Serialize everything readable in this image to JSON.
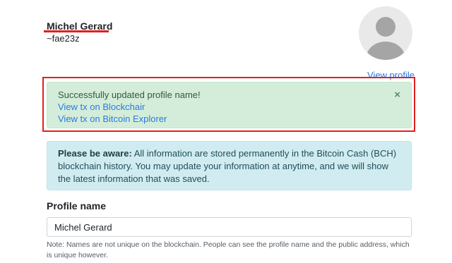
{
  "profile": {
    "name": "Michel Gerard",
    "handle": "~fae23z",
    "view_profile_label": "View profile"
  },
  "success_alert": {
    "message": "Successfully updated profile name!",
    "link_blockchair": "View tx on Blockchair",
    "link_explorer": "View tx on Bitcoin Explorer",
    "close_symbol": "×"
  },
  "info_alert": {
    "bold_label": "Please be aware:",
    "text": " All information are stored permanently in the Bitcoin Cash (BCH) blockchain history. You may update your information at anytime, and we will show the latest information that was saved."
  },
  "form": {
    "label": "Profile name",
    "value": "Michel Gerard",
    "note": "Note: Names are not unique on the blockchain. People can see the profile name and the public address, which is unique however."
  },
  "colors": {
    "highlight": "#e02020",
    "link": "#2a7ae2",
    "success_bg": "#d4edda",
    "info_bg": "#d1ecf1"
  },
  "icons": {
    "avatar": "user-silhouette-icon",
    "close": "close-icon"
  }
}
